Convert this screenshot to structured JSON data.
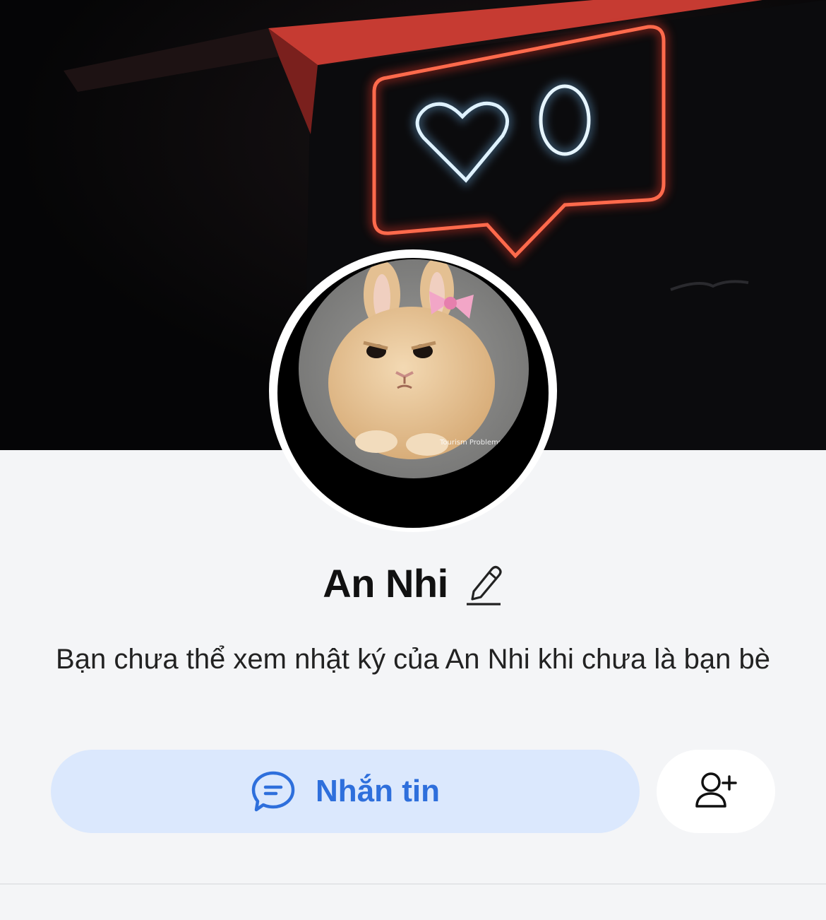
{
  "profile": {
    "name": "An Nhi",
    "notice": "Bạn chưa thể xem nhật ký của An Nhi khi chưa là bạn bè",
    "cover_icon": "neon-like-sign",
    "avatar_icon": "bunny-avatar",
    "avatar_watermark": "Tourism Problems"
  },
  "actions": {
    "message_label": "Nhắn tin",
    "message_icon": "chat-bubble-icon",
    "add_friend_icon": "add-friend-icon",
    "edit_icon": "pencil-icon"
  },
  "colors": {
    "accent": "#2e6fdc",
    "accent_bg": "#dbe8fd",
    "page_bg": "#f4f5f7"
  }
}
